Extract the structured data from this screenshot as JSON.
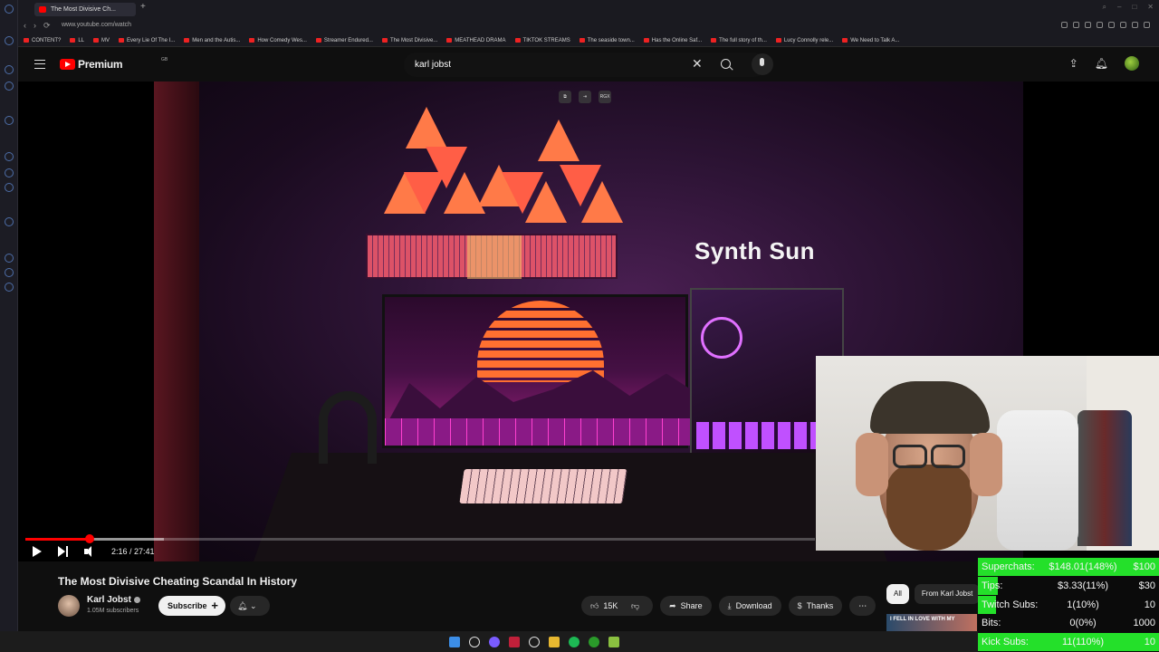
{
  "browser": {
    "tab_title": "The Most Divisive Ch...",
    "url": "www.youtube.com/watch",
    "bookmarks": [
      "CONTENT?",
      "LL",
      "MV",
      "Every Lie Of The I...",
      "Men and the Autis...",
      "How Comedy Wes...",
      "Streamer Endured...",
      "The Most Divisive...",
      "MEATHEAD DRAMA",
      "TIKTOK STREAMS",
      "The seaside town...",
      "Has the Online Saf...",
      "The full story of th...",
      "Lucy Connolly rele...",
      "We Need to Talk A..."
    ]
  },
  "header": {
    "logo_text": "Premium",
    "logo_sup": "GB",
    "search_query": "karl jobst"
  },
  "video": {
    "overlay_text": "Synth Sun",
    "overlay_badge": "RGX",
    "timecode": "2:16 / 27:41",
    "progress": {
      "current_seconds": 136,
      "duration_seconds": 1661,
      "buffered_fraction": 0.175
    },
    "title": "The Most Divisive Cheating Scandal In History"
  },
  "channel": {
    "name": "Karl Jobst",
    "subscribers": "1.05M subscribers",
    "subscribe_label": "Subscribe"
  },
  "actions": {
    "likes": "15K",
    "share": "Share",
    "download": "Download",
    "thanks": "Thanks"
  },
  "chips": [
    "All",
    "From Karl Jobst"
  ],
  "related_thumb_text": "I FELL IN LOVE WITH MY",
  "stats": [
    {
      "label": "Superchats:",
      "value": "$148.01(148%)",
      "goal": "$100",
      "fill_fraction": 1.0
    },
    {
      "label": "Tips:",
      "value": "$3.33(11%)",
      "goal": "$30",
      "fill_fraction": 0.11
    },
    {
      "label": "Twitch Subs:",
      "value": "1(10%)",
      "goal": "10",
      "fill_fraction": 0.1
    },
    {
      "label": "Bits:",
      "value": "0(0%)",
      "goal": "1000",
      "fill_fraction": 0.0
    },
    {
      "label": "Kick Subs:",
      "value": "11(110%)",
      "goal": "10",
      "fill_fraction": 1.0
    }
  ],
  "colors": {
    "accent": "#ff0000",
    "stat_bar": "#24e02a",
    "background": "#0f0f0f"
  }
}
